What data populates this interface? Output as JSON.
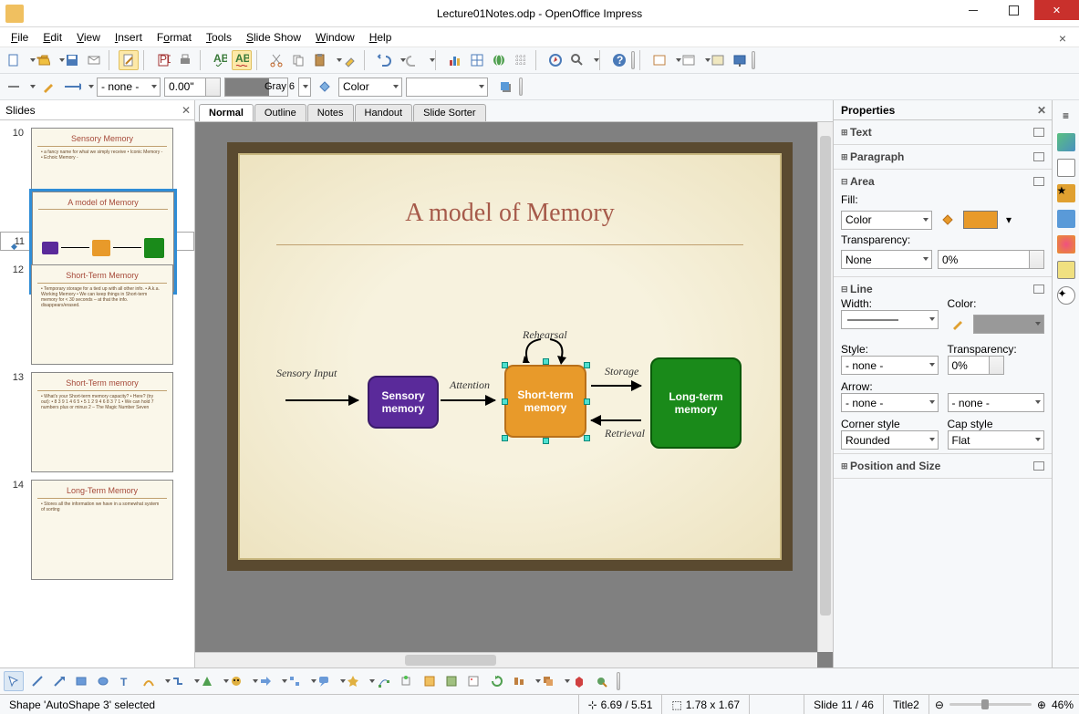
{
  "title": "Lecture01Notes.odp - OpenOffice Impress",
  "menu": [
    "File",
    "Edit",
    "View",
    "Insert",
    "Format",
    "Tools",
    "Slide Show",
    "Window",
    "Help"
  ],
  "toolbar2": {
    "style": "- none -",
    "width": "0.00\"",
    "colorName": "Gray 6",
    "fillType": "Color"
  },
  "slidesPanel": {
    "title": "Slides"
  },
  "thumbs": [
    {
      "num": "10",
      "title": "Sensory Memory",
      "body": "• a fancy name for what we simply receive\n• Iconic Memory -\n• Echoic Memory -"
    },
    {
      "num": "11",
      "title": "A model of Memory",
      "body": ""
    },
    {
      "num": "12",
      "title": "Short-Term Memory",
      "body": "• Temporary storage for a tied up with all other info.\n• A.k.a. Working Memory\n• We can keep things in Short-term memory for < 30 seconds – at that the info. disappears/erased."
    },
    {
      "num": "13",
      "title": "Short-Term memory",
      "body": "• What's your Short-term memory capacity?\n• Here? (try out):\n  • 8 3 9 1 4 6 5\n  • 5 1 2 9 4 6 8 3 7 1\n• We can hold 7 numbers plus or minus 2 – The Magic Number Seven"
    },
    {
      "num": "14",
      "title": "Long-Term Memory",
      "body": "• Stores all the information we have in a somewhat system of sorting"
    }
  ],
  "tabs": [
    "Normal",
    "Outline",
    "Notes",
    "Handout",
    "Slide Sorter"
  ],
  "activeTab": "Normal",
  "slide": {
    "title": "A model of Memory",
    "labels": {
      "sensoryInput": "Sensory Input",
      "attention": "Attention",
      "rehearsal": "Rehearsal",
      "storage": "Storage",
      "retrieval": "Retrieval"
    },
    "boxes": {
      "sensory": "Sensory\nmemory",
      "shortterm": "Short-term\nmemory",
      "longterm": "Long-term\nmemory"
    }
  },
  "props": {
    "title": "Properties",
    "sections": {
      "text": "Text",
      "paragraph": "Paragraph",
      "area": "Area",
      "line": "Line",
      "possize": "Position and Size"
    },
    "area": {
      "fillLabel": "Fill:",
      "fillType": "Color",
      "transLabel": "Transparency:",
      "transType": "None",
      "transVal": "0%",
      "fillColor": "#e89a2a"
    },
    "line": {
      "widthLabel": "Width:",
      "colorLabel": "Color:",
      "styleLabel": "Style:",
      "style": "- none -",
      "transLabel": "Transparency:",
      "trans": "0%",
      "arrowLabel": "Arrow:",
      "arrow1": "- none -",
      "arrow2": "- none -",
      "cornerLabel": "Corner style",
      "corner": "Rounded",
      "capLabel": "Cap style",
      "cap": "Flat"
    }
  },
  "status": {
    "selection": "Shape 'AutoShape 3' selected",
    "pos": "6.69 / 5.51",
    "size": "1.78 x 1.67",
    "slide": "Slide 11 / 46",
    "master": "Title2",
    "zoom": "46%"
  }
}
